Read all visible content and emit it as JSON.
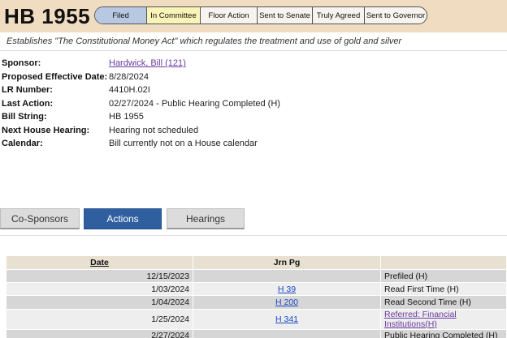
{
  "bill": {
    "title": "HB 1955",
    "summary": "Establishes \"The Constitutional Money Act\" which regulates the treatment and use of gold and silver"
  },
  "status_steps": [
    {
      "label": "Filed"
    },
    {
      "label": "In Committee"
    },
    {
      "label": "Floor Action"
    },
    {
      "label": "Sent to Senate"
    },
    {
      "label": "Truly Agreed"
    },
    {
      "label": "Sent to Governor"
    }
  ],
  "details": {
    "sponsor": {
      "label": "Sponsor:",
      "value": "Hardwick, Bill (121)"
    },
    "effective_date": {
      "label": "Proposed Effective Date:",
      "value": "8/28/2024"
    },
    "lr_number": {
      "label": "LR Number:",
      "value": "4410H.02I"
    },
    "last_action": {
      "label": "Last Action:",
      "value": "02/27/2024 - Public Hearing Completed (H)"
    },
    "bill_string": {
      "label": "Bill String:",
      "value": "HB 1955"
    },
    "next_hearing": {
      "label": "Next House Hearing:",
      "value": "Hearing not scheduled"
    },
    "calendar": {
      "label": "Calendar:",
      "value": "Bill currently not on a House calendar"
    }
  },
  "tabs": {
    "cosponsors": "Co-Sponsors",
    "actions": "Actions",
    "hearings": "Hearings"
  },
  "actions_table": {
    "headers": {
      "date": "Date",
      "jrn_pg": "Jrn Pg",
      "description": ""
    },
    "rows": [
      {
        "date": "12/15/2023",
        "jrn_pg": "",
        "description": "Prefiled (H)"
      },
      {
        "date": "1/03/2024",
        "jrn_pg": "H 39",
        "description": "Read First Time (H)"
      },
      {
        "date": "1/04/2024",
        "jrn_pg": "H 200",
        "description": "Read Second Time (H)"
      },
      {
        "date": "1/25/2024",
        "jrn_pg": "H 341",
        "description": "Referred: Financial Institutions(H)"
      },
      {
        "date": "2/27/2024",
        "jrn_pg": "",
        "description": "Public Hearing Completed (H)"
      }
    ]
  },
  "colors": {
    "header_band": "#f0dcc0",
    "active_step": "#b8c8e2",
    "current_step": "#fbf4b8",
    "active_tab": "#2f5f9f",
    "link": "#1a47c4",
    "visited_link": "#6a3aa0"
  }
}
